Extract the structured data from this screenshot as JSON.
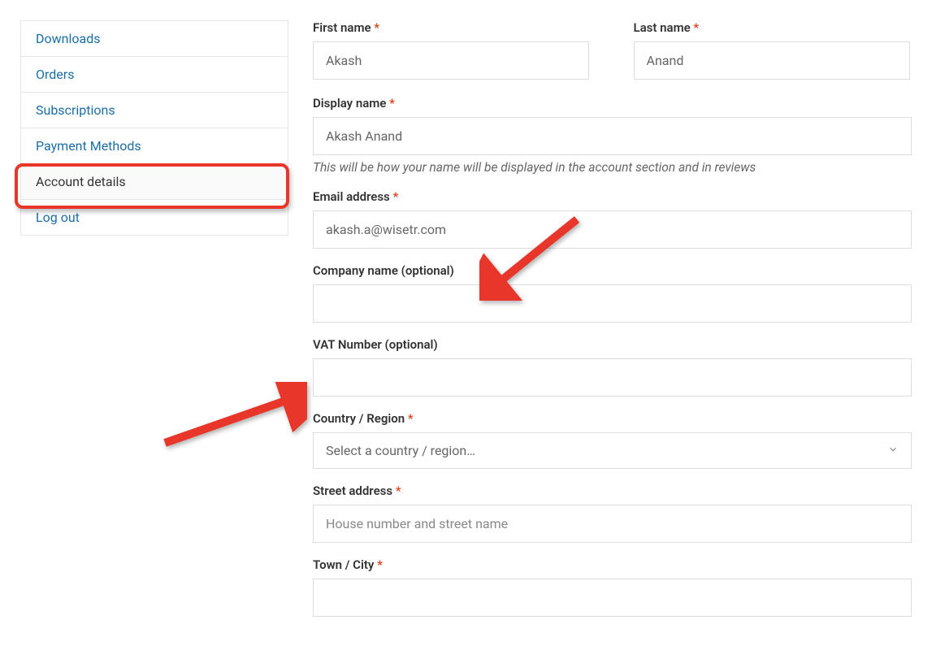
{
  "sidebar": {
    "items": [
      {
        "label": "Downloads"
      },
      {
        "label": "Orders"
      },
      {
        "label": "Subscriptions"
      },
      {
        "label": "Payment Methods"
      },
      {
        "label": "Account details"
      },
      {
        "label": "Log out"
      }
    ],
    "active_index": 4
  },
  "form": {
    "first_name": {
      "label": "First name",
      "value": "Akash",
      "required": true
    },
    "last_name": {
      "label": "Last name",
      "value": "Anand",
      "required": true
    },
    "display_name": {
      "label": "Display name",
      "value": "Akash Anand",
      "required": true,
      "helper": "This will be how your name will be displayed in the account section and in reviews"
    },
    "email": {
      "label": "Email address",
      "value": "akash.a@wisetr.com",
      "required": true
    },
    "company": {
      "label": "Company name (optional)",
      "value": ""
    },
    "vat": {
      "label": "VAT Number (optional)",
      "value": ""
    },
    "country": {
      "label": "Country / Region",
      "placeholder": "Select a country / region…",
      "required": true
    },
    "street": {
      "label": "Street address",
      "placeholder": "House number and street name",
      "value": "",
      "required": true
    },
    "city": {
      "label": "Town / City",
      "value": "",
      "required": true
    }
  },
  "required_marker": "*",
  "colors": {
    "link": "#1a6ea8",
    "required": "#e2401c",
    "annotation": "#e8362a"
  }
}
